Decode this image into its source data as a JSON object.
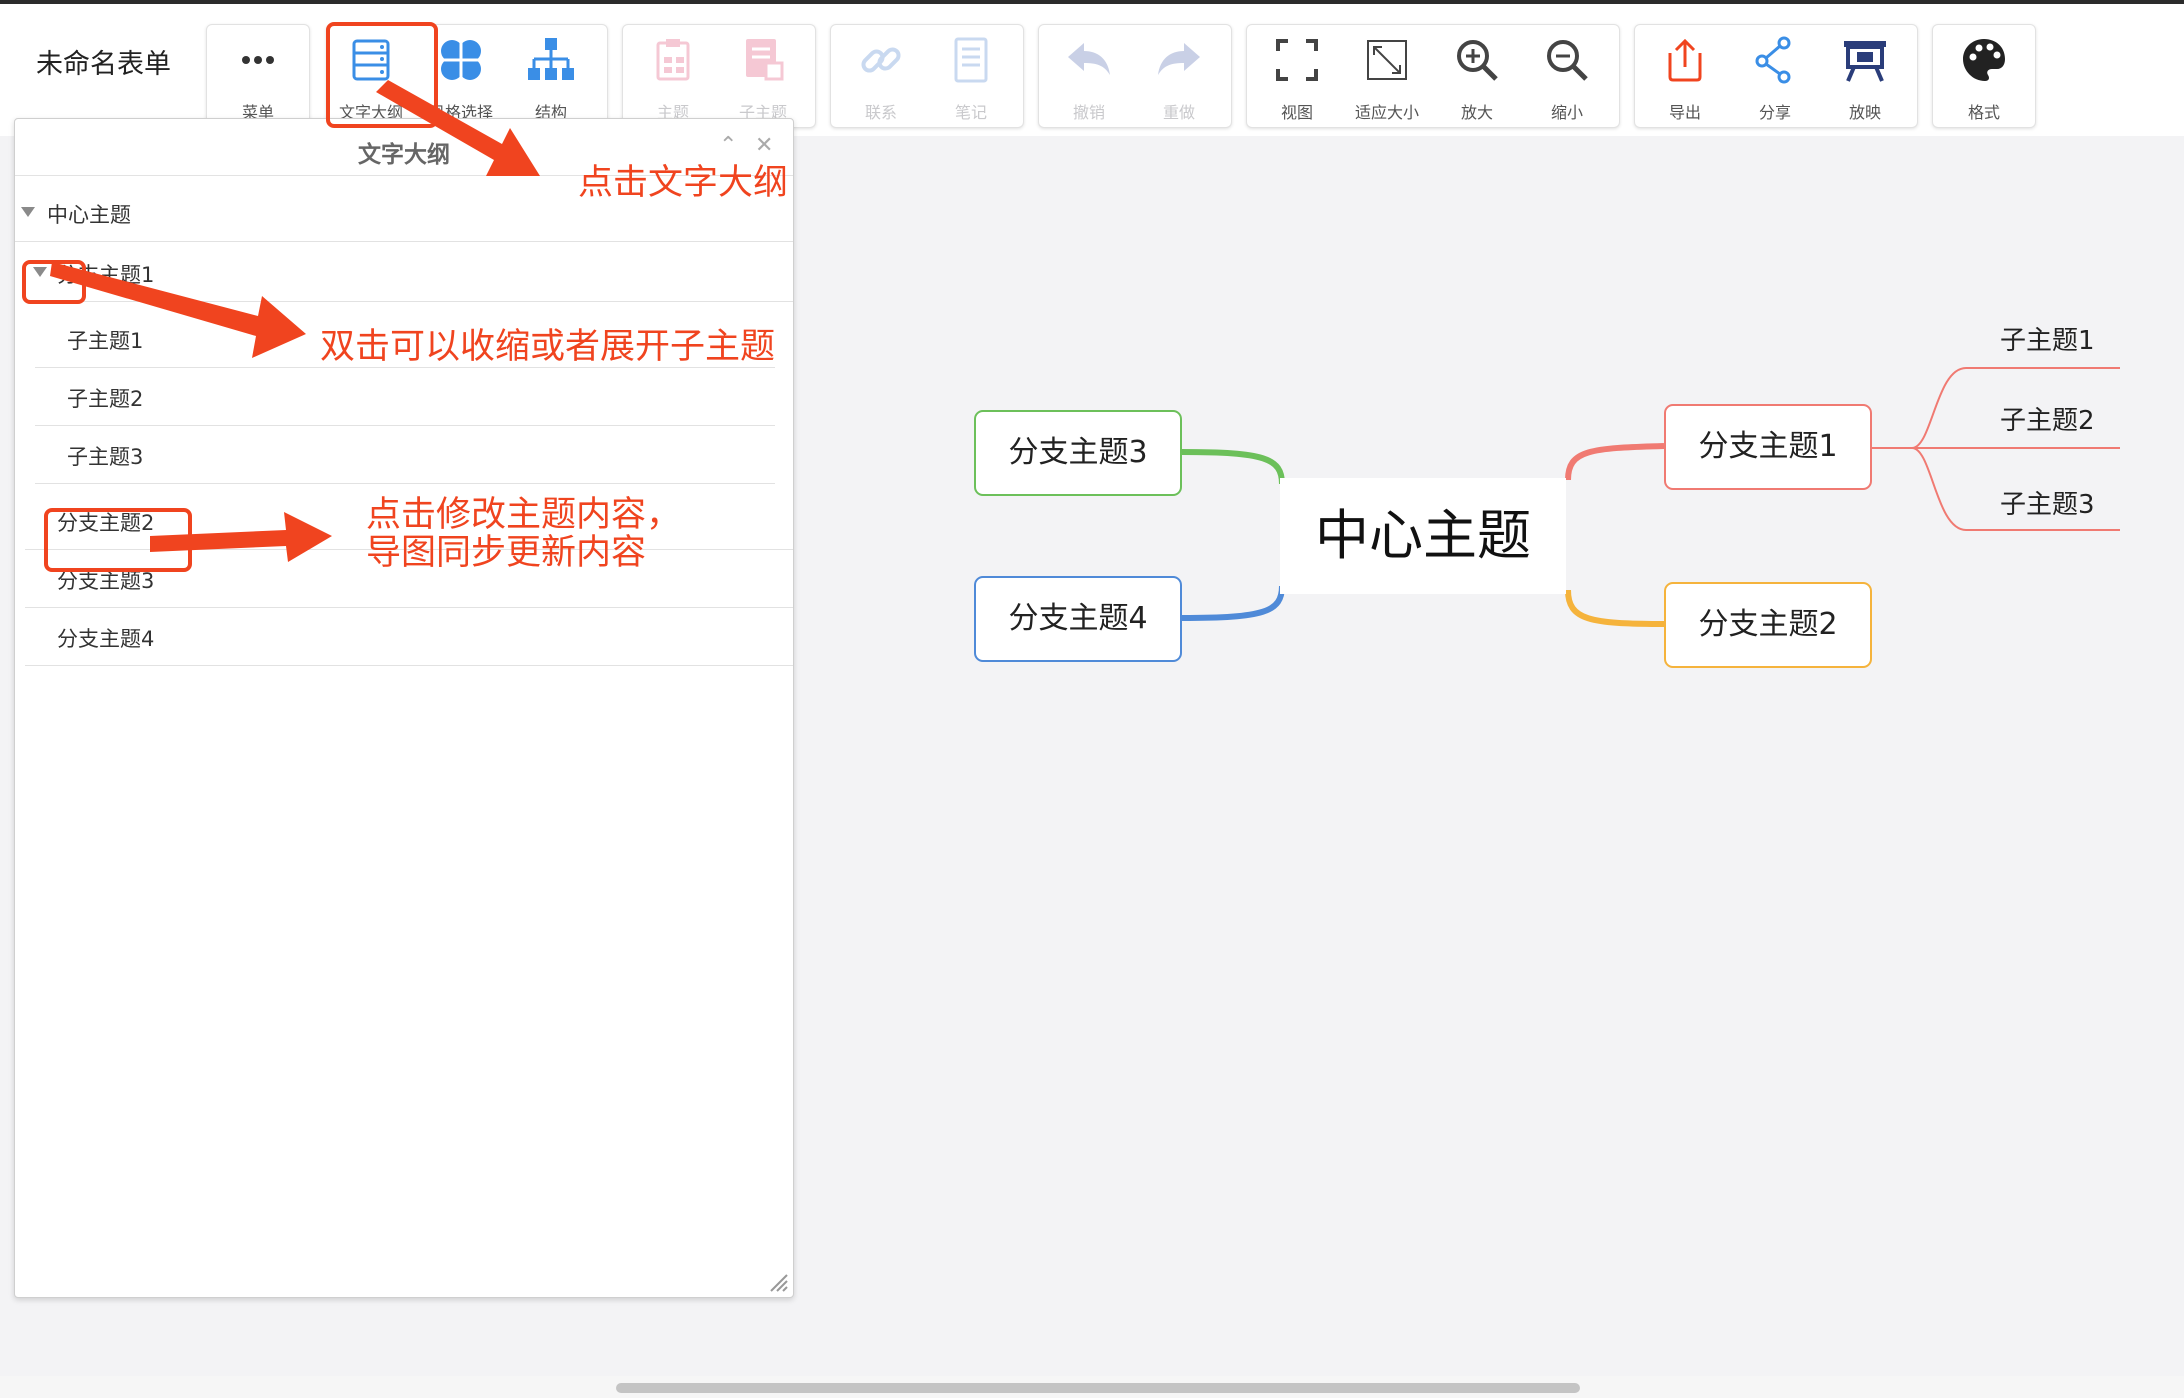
{
  "app": {
    "title": "未命名表单"
  },
  "toolbar": {
    "menu": "菜单",
    "outline": "文字大纲",
    "style": "风格选择",
    "structure": "结构",
    "topic": "主题",
    "subtopic": "子主题",
    "relation": "联系",
    "note": "笔记",
    "undo": "撤销",
    "redo": "重做",
    "view": "视图",
    "fit": "适应大小",
    "zoom_in": "放大",
    "zoom_out": "缩小",
    "export": "导出",
    "share": "分享",
    "present": "放映",
    "format": "格式"
  },
  "panel": {
    "title": "文字大纲",
    "rows": [
      "中心主题",
      "分支主题1",
      "子主题1",
      "子主题2",
      "子主题3",
      "分支主题2",
      "分支主题3",
      "分支主题4"
    ]
  },
  "annotations": {
    "a1": "点击文字大纲",
    "a2": "双击可以收缩或者展开子主题",
    "a3_line1": "点击修改主题内容，",
    "a3_line2": "导图同步更新内容"
  },
  "map": {
    "center": "中心主题",
    "branch1": "分支主题1",
    "branch2": "分支主题2",
    "branch3": "分支主题3",
    "branch4": "分支主题4",
    "sub1": "子主题1",
    "sub2": "子主题2",
    "sub3": "子主题3"
  },
  "colors": {
    "accent_red": "#f0441f",
    "icon_blue": "#3a8ee6",
    "branch1": "#f07a72",
    "branch2": "#f5b33c",
    "branch3": "#6cc05a",
    "branch4": "#4f8ad8",
    "present_navy": "#2a3d7a",
    "disabled": "#c9d9f0"
  }
}
